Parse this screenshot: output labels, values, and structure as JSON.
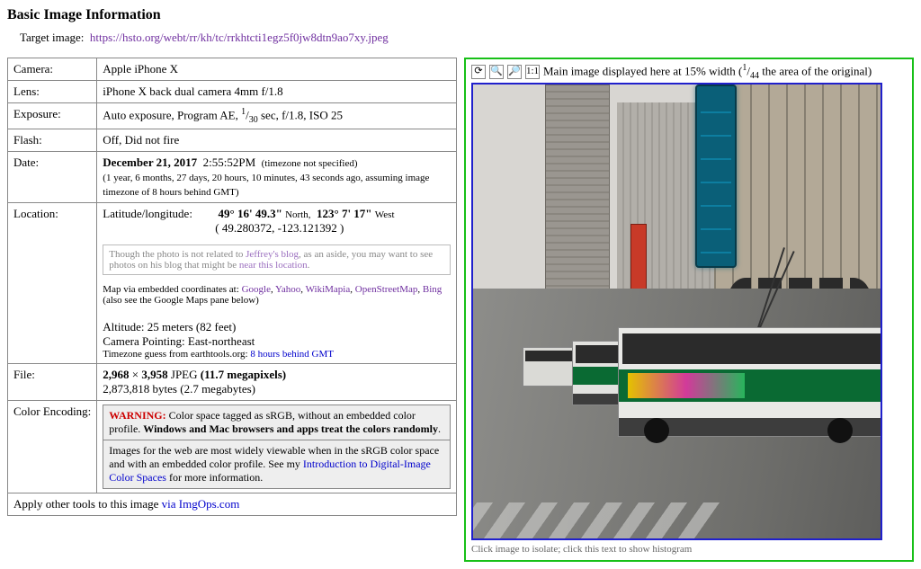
{
  "header": {
    "title": "Basic Image Information"
  },
  "target": {
    "label": "Target image:",
    "url": "https://hsto.org/webt/rr/kh/tc/rrkhtcti1egz5f0jw8dtn9ao7xy.jpeg"
  },
  "rows": {
    "camera": {
      "label": "Camera:",
      "value": "Apple iPhone X"
    },
    "lens": {
      "label": "Lens:",
      "value": "iPhone X back dual camera 4mm f/1.8"
    },
    "exposure": {
      "label": "Exposure:",
      "prefix": "Auto exposure, Program AE, ",
      "frac_num": "1",
      "frac_den": "30",
      "suffix": " sec, f/1.8, ISO 25"
    },
    "flash": {
      "label": "Flash:",
      "value": "Off, Did not fire"
    },
    "date": {
      "label": "Date:",
      "datebold": "December 21, 2017",
      "time": "2:55:52PM",
      "tznote": "(timezone not specified)",
      "ago": "(1 year, 6 months, 27 days, 20 hours, 10 minutes, 43 seconds ago, assuming image timezone of 8 hours behind GMT)"
    },
    "location": {
      "label": "Location:",
      "latlng_label": "Latitude/longitude:",
      "lat_deg": "49° 16' 49.3\"",
      "lat_dir": "North,",
      "lng_deg": "123° 7' 17\"",
      "lng_dir": "West",
      "decimal": "( 49.280372, -123.121392 )",
      "aside_pre": "Though the photo is not related to ",
      "aside_link1": "Jeffrey's blog",
      "aside_mid": ", as an aside, you may want to see photos on his blog that might be ",
      "aside_link2": "near this location",
      "aside_post": ".",
      "mapline_pre": "Map via embedded coordinates at: ",
      "map_google": "Google",
      "map_yahoo": "Yahoo",
      "map_wikimapia": "WikiMapia",
      "map_osm": "OpenStreetMap",
      "map_bing": "Bing",
      "mapline_note": "(also see the Google Maps pane below)",
      "altitude": "Altitude: 25 meters (82 feet)",
      "pointing": "Camera Pointing: East-northeast",
      "tzguess_pre": "Timezone guess from earthtools.org: ",
      "tzguess_link": "8 hours behind GMT"
    },
    "file": {
      "label": "File:",
      "dims_a": "2,968",
      "dims_x": " × ",
      "dims_b": "3,958",
      "fmt": " JPEG ",
      "mp": "(11.7 megapixels)",
      "bytes": "2,873,818 bytes (2.7 megabytes)"
    },
    "color": {
      "label": "Color Encoding:",
      "warn": "WARNING:",
      "warn_mid": " Color space tagged as sRGB, without an embedded color profile. ",
      "warn_bold": "Windows and Mac browsers and apps treat the colors randomly",
      "warn_post": ".",
      "p2_pre": "Images for the web are most widely viewable when in the sRGB color space and with an embedded color profile. See my ",
      "p2_link": "Introduction to Digital-Image Color Spaces",
      "p2_post": " for more information."
    }
  },
  "footer": {
    "pre": "Apply other tools to this image ",
    "link": "via ImgOps.com"
  },
  "preview": {
    "caption_pre": "Main image displayed here at 15% width (",
    "frac_num": "1",
    "frac_den": "44",
    "caption_post": " the area of the original)",
    "sub_caption": "Click image to isolate; click this text to show histogram",
    "icons": {
      "clock": "⟳",
      "zoom_out": "🔍",
      "zoom_in": "🔎",
      "onetoone": "1:1"
    }
  }
}
